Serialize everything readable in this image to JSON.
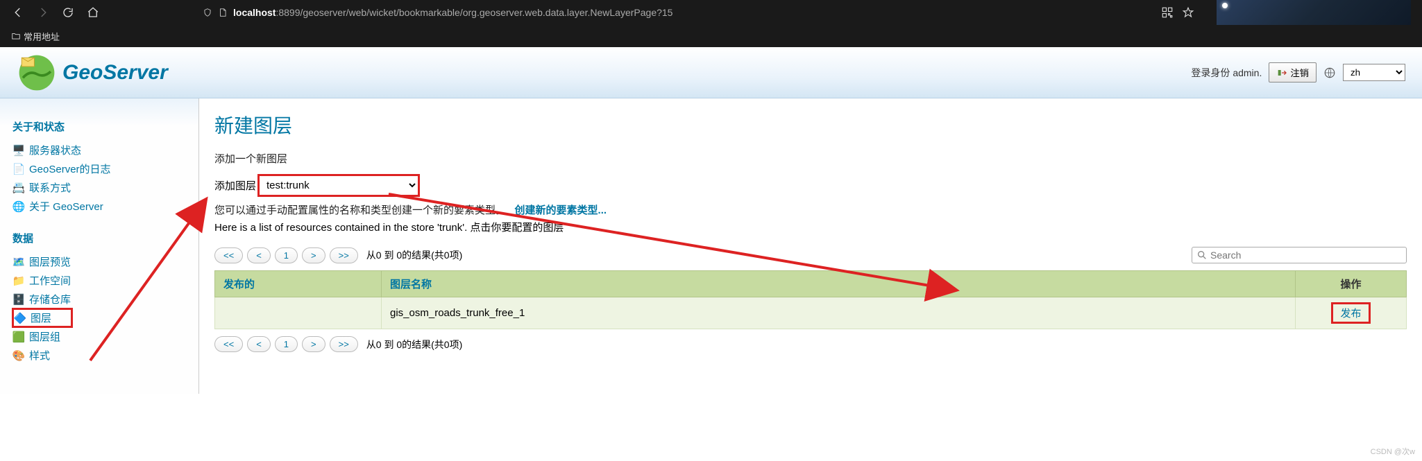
{
  "browser": {
    "host": "localhost",
    "rest": ":8899/geoserver/web/wicket/bookmarkable/org.geoserver.web.data.layer.NewLayerPage?15",
    "bookmark_label": "常用地址"
  },
  "header": {
    "logo_text": "GeoServer",
    "login_prefix": "登录身份",
    "login_user": "admin.",
    "logout": "注销",
    "lang": "zh"
  },
  "sidebar": {
    "sections": [
      {
        "title": "关于和状态",
        "items": [
          {
            "label": "服务器状态",
            "icon": "server-status-icon"
          },
          {
            "label": "GeoServer的日志",
            "icon": "log-icon"
          },
          {
            "label": "联系方式",
            "icon": "contact-icon"
          },
          {
            "label": "关于 GeoServer",
            "icon": "about-icon"
          }
        ]
      },
      {
        "title": "数据",
        "items": [
          {
            "label": "图层预览",
            "icon": "layer-preview-icon"
          },
          {
            "label": "工作空间",
            "icon": "workspace-icon"
          },
          {
            "label": "存储仓库",
            "icon": "store-icon"
          },
          {
            "label": "图层",
            "icon": "layer-icon",
            "active": true
          },
          {
            "label": "图层组",
            "icon": "layergroup-icon"
          },
          {
            "label": "样式",
            "icon": "style-icon"
          }
        ]
      }
    ]
  },
  "main": {
    "title": "新建图层",
    "subtitle": "添加一个新图层",
    "add_label": "添加图层",
    "store_value": "test:trunk",
    "hint_text": "您可以通过手动配置属性的名称和类型创建一个新的要素类型。",
    "hint_link": "创建新的要素类型...",
    "resource_hint": "Here is a list of resources contained in the store 'trunk'. 点击你要配置的图层",
    "pager": {
      "first": "<<",
      "prev": "<",
      "page": "1",
      "next": ">",
      "last": ">>",
      "text": "从0 到 0的结果(共0项)"
    },
    "search_placeholder": "Search",
    "columns": {
      "published": "发布的",
      "name": "图层名称",
      "op": "操作"
    },
    "rows": [
      {
        "published": "",
        "name": "gis_osm_roads_trunk_free_1",
        "op": "发布"
      }
    ]
  },
  "watermark": "CSDN @次w"
}
